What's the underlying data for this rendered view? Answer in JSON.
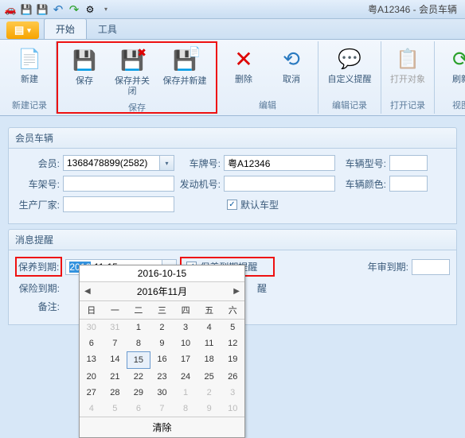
{
  "window_title": "粤A12346 - 会员车辆",
  "tabs": {
    "start": "开始",
    "tools": "工具"
  },
  "ribbon": {
    "new": "新建",
    "save": "保存",
    "save_close": "保存并关闭",
    "save_new": "保存并新建",
    "delete": "删除",
    "cancel": "取消",
    "custom_remind": "自定义提醒",
    "open_obj": "打开对象",
    "refresh": "刷新",
    "grp_new": "新建记录",
    "grp_save": "保存",
    "grp_edit": "编辑",
    "grp_editrec": "编辑记录",
    "grp_open": "打开记录",
    "grp_view": "视图"
  },
  "panel1_title": "会员车辆",
  "labels": {
    "member": "会员:",
    "plate": "车牌号:",
    "model": "车辆型号:",
    "vin": "车架号:",
    "engine": "发动机号:",
    "color": "车辆颜色:",
    "maker": "生产厂家:",
    "default_model": "默认车型",
    "maint_due": "保养到期:",
    "maint_remind": "保养到期提醒",
    "audit_due": "年审到期:",
    "ins_due": "保险到期:",
    "remind_suffix": "醒",
    "remark": "备注:"
  },
  "values": {
    "member": "1368478899(2582)",
    "plate": "粤A12346",
    "model": "",
    "vin": "",
    "engine": "",
    "color": "",
    "maker": "",
    "default_model_checked": true,
    "maint_due_sel": "2016",
    "maint_due_rest": "-11-15",
    "maint_remind_checked": true,
    "audit_due": "",
    "ins_due": ""
  },
  "panel2_title": "消息提醒",
  "datepicker": {
    "display": "2016-10-15",
    "header": "2016年11月",
    "weekdays": [
      "日",
      "一",
      "二",
      "三",
      "四",
      "五",
      "六"
    ],
    "clear": "清除",
    "selected_day": 15,
    "prev_month_days": [
      30,
      31
    ],
    "days_in_month": 30,
    "next_month_days": [
      1,
      2,
      3,
      4,
      5,
      6,
      7,
      8,
      9,
      10
    ]
  }
}
